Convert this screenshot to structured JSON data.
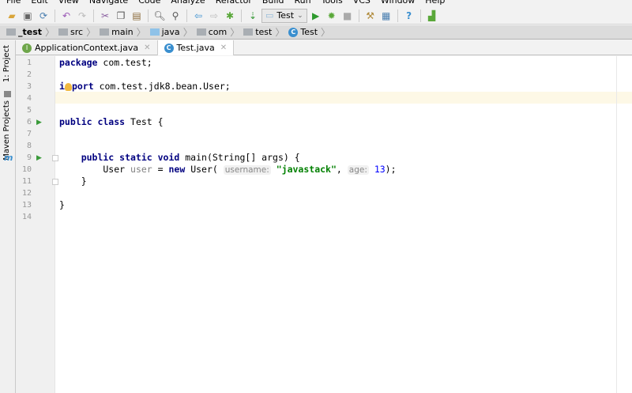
{
  "menu": [
    "File",
    "Edit",
    "View",
    "Navigate",
    "Code",
    "Analyze",
    "Refactor",
    "Build",
    "Run",
    "Tools",
    "VCS",
    "Window",
    "Help"
  ],
  "toolbar": {
    "run_config": "Test",
    "icons": [
      "open-icon",
      "save-icon",
      "sync-icon",
      "undo-icon",
      "redo-icon",
      "cut-icon",
      "copy-icon",
      "paste-icon",
      "find-icon",
      "replace-icon",
      "back-icon",
      "forward-icon",
      "make-icon",
      "build-icon",
      "run-icon",
      "debug-icon",
      "stop-icon",
      "settings-icon",
      "project-structure-icon",
      "help-icon",
      "vcs-icon"
    ]
  },
  "breadcrumb": [
    "_test",
    "src",
    "main",
    "java",
    "com",
    "test",
    "Test"
  ],
  "tabs": [
    {
      "label": "ApplicationContext.java",
      "active": false
    },
    {
      "label": "Test.java",
      "active": true
    }
  ],
  "side_tools": [
    "1: Project",
    "Maven Projects"
  ],
  "editor": {
    "line_numbers": [
      "1",
      "2",
      "3",
      "4",
      "5",
      "6",
      "7",
      "8",
      "9",
      "10",
      "11",
      "12",
      "13",
      "14"
    ],
    "code": {
      "l1_kw": "package",
      "l1_rest": " com.test;",
      "l3_a": "i",
      "l3_b": "port",
      "l3_rest": " com.test.jdk8.bean.User;",
      "l6_kw": "public class",
      "l6_rest": " Test {",
      "l9_kw": "    public static void",
      "l9_rest": " main(String[] args) {",
      "l10_a": "        User ",
      "l10_var": "user",
      "l10_b": " = ",
      "l10_new": "new",
      "l10_c": " User( ",
      "l10_hint1": "username:",
      "l10_str": "\"javastack\"",
      "l10_d": ", ",
      "l10_hint2": "age:",
      "l10_num": "13",
      "l10_e": ");",
      "l11": "    }",
      "l13": "}"
    },
    "current_line": "4"
  },
  "colors": {
    "keyword": "#000080",
    "string": "#008000",
    "number": "#0000ff",
    "current_line": "#fdf8e6"
  }
}
